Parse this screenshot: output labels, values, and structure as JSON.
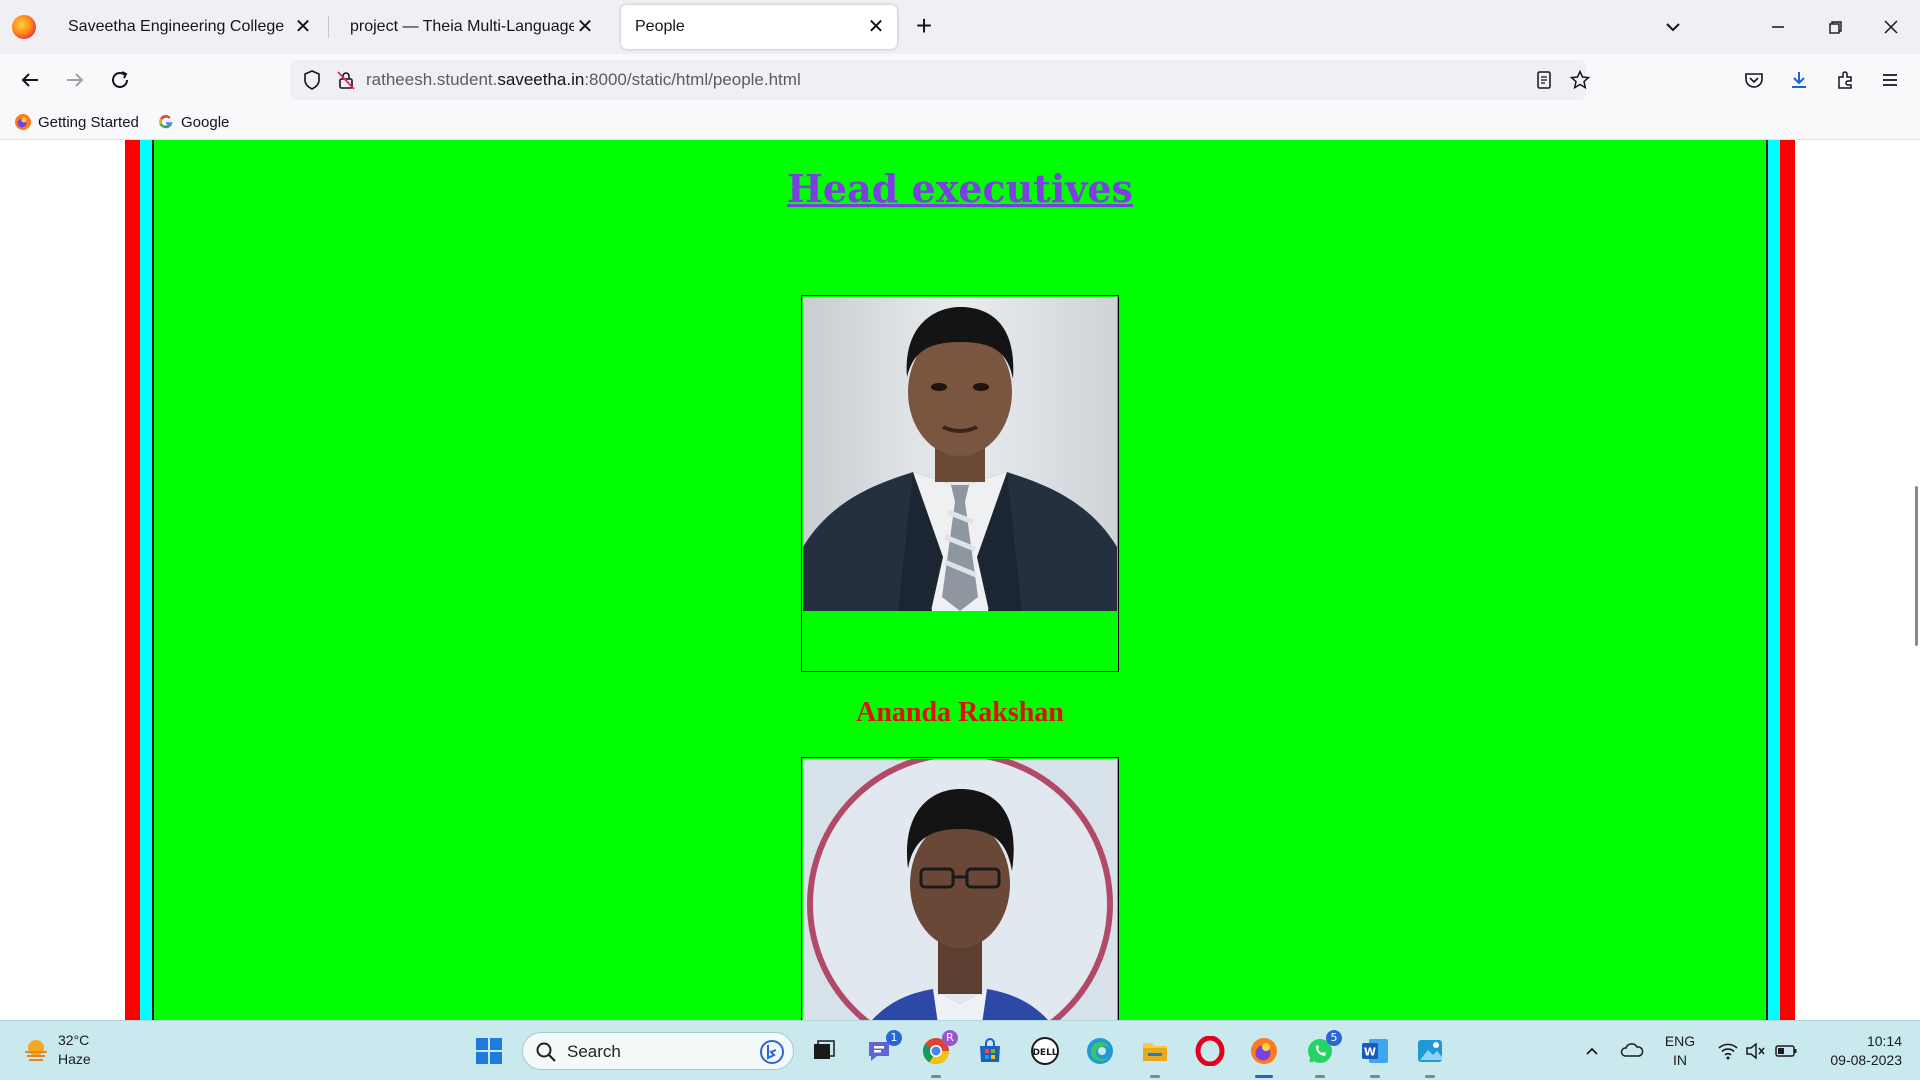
{
  "browser": {
    "tabs": [
      {
        "label": "Saveetha Engineering College",
        "active": false
      },
      {
        "label": "project — Theia Multi-Language Ex",
        "active": false
      },
      {
        "label": "People",
        "active": true
      }
    ],
    "new_tab_label": "+",
    "url_prefix": "ratheesh.student.",
    "url_domain": "saveetha.in",
    "url_suffix": ":8000/static/html/people.html",
    "bookmarks": [
      {
        "label": "Getting Started",
        "icon": "firefox-icon"
      },
      {
        "label": "Google",
        "icon": "google-icon"
      }
    ]
  },
  "page": {
    "heading": "Head executives",
    "people": [
      {
        "name": "Ananda Rakshan"
      }
    ],
    "colors": {
      "outer_border": "#ff0000",
      "inner_border": "#00ffff",
      "background": "#00ff00",
      "heading": "#7b3fe4",
      "name": "#e01010"
    }
  },
  "taskbar": {
    "weather_temp": "32°C",
    "weather_desc": "Haze",
    "search_placeholder": "Search",
    "teams_badge": "1",
    "whatsapp_badge": "5",
    "chrome_badge": "R",
    "lang_top": "ENG",
    "lang_bottom": "IN",
    "time": "10:14",
    "date": "09-08-2023"
  }
}
